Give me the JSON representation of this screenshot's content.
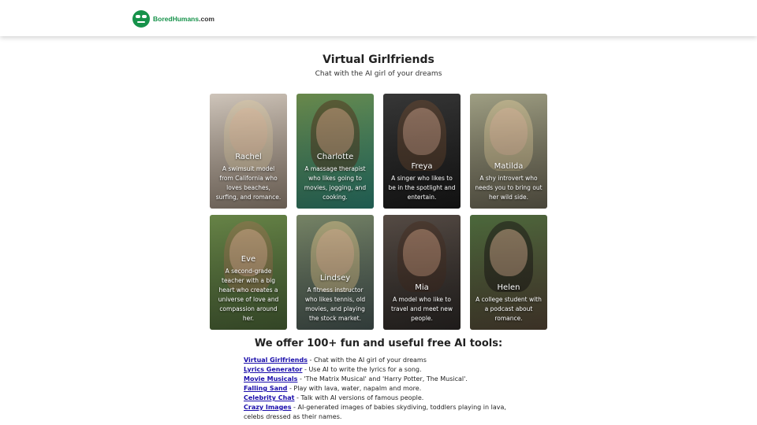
{
  "header": {
    "logo_text_a": "Bored",
    "logo_text_b": "Humans",
    "logo_text_c": ".com"
  },
  "page": {
    "title": "Virtual Girlfriends",
    "subtitle": "Chat with the AI girl of your dreams"
  },
  "cards": [
    {
      "name": "Rachel",
      "desc": "A swimsuit model from California who loves beaches, surfing, and romance."
    },
    {
      "name": "Charlotte",
      "desc": "A massage therapist who likes going to movies, jogging, and cooking."
    },
    {
      "name": "Freya",
      "desc": "A singer who likes to be in the spotlight and entertain."
    },
    {
      "name": "Matilda",
      "desc": "A shy introvert who needs you to bring out her wild side."
    },
    {
      "name": "Eve",
      "desc": "A second-grade teacher with a big heart who creates a universe of love and compassion around her."
    },
    {
      "name": "Lindsey",
      "desc": "A fitness instructor who likes tennis, old movies, and playing the stock market."
    },
    {
      "name": "Mia",
      "desc": "A model who like to travel and meet new people."
    },
    {
      "name": "Helen",
      "desc": "A college student with a podcast about romance."
    }
  ],
  "offer_heading": "We offer 100+ fun and useful free AI tools:",
  "tools": [
    {
      "label": "Virtual Girlfriends",
      "desc": " - Chat with the AI girl of your dreams"
    },
    {
      "label": "Lyrics Generator",
      "desc": " - Use AI to write the lyrics for a song."
    },
    {
      "label": "Movie Musicals",
      "desc": " - 'The Matrix Musical' and 'Harry Potter, The Musical'."
    },
    {
      "label": "Falling Sand",
      "desc": " - Play with lava, water, napalm and more."
    },
    {
      "label": "Celebrity Chat",
      "desc": " - Talk with AI versions of famous people."
    },
    {
      "label": "Crazy Images",
      "desc": " - AI-generated images of babies skydiving, toddlers playing in lava, celebs dressed as their names."
    }
  ]
}
